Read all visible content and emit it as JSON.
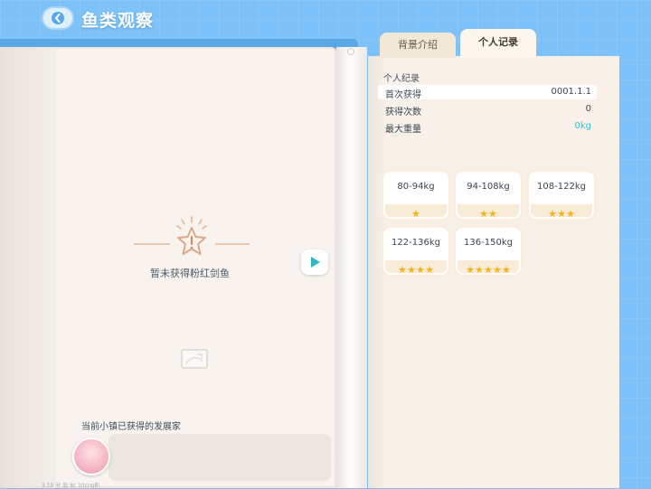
{
  "header": {
    "title": "鱼类观察"
  },
  "tabs": [
    {
      "label": "背景介绍",
      "active": false
    },
    {
      "label": "个人记录",
      "active": true
    }
  ],
  "empty_state": {
    "text": "暂未获得粉红剑鱼"
  },
  "developers": {
    "title": "当前小镇已获得的发展家"
  },
  "record": {
    "title": "个人纪录",
    "rows": [
      {
        "key": "首次获得",
        "value": "0001.1.1"
      },
      {
        "key": "获得次数",
        "value": "0"
      },
      {
        "key": "最大重量",
        "value": "0kg"
      }
    ]
  },
  "weight_cards": [
    {
      "range": "80-94kg",
      "stars": 1
    },
    {
      "range": "94-108kg",
      "stars": 2
    },
    {
      "range": "108-122kg",
      "stars": 3
    },
    {
      "range": "122-136kg",
      "stars": 4
    },
    {
      "range": "136-150kg",
      "stars": 5
    }
  ],
  "colors": {
    "accent_value": "#35c0c9",
    "star": "#f6b41b",
    "background": "#7cc1f7"
  },
  "bottom_text": "3.10   分.加   8c 10cng叭"
}
